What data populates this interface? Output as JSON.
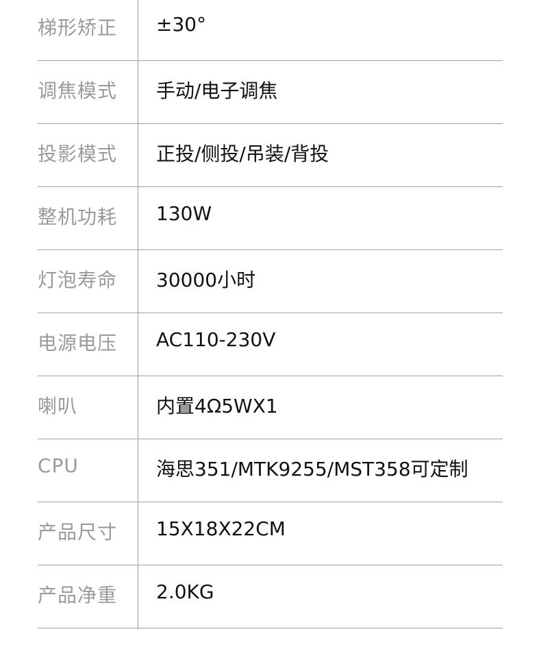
{
  "specs": [
    {
      "label": "梯形矫正",
      "value": "±30°"
    },
    {
      "label": "调焦模式",
      "value": "手动/电子调焦"
    },
    {
      "label": "投影模式",
      "value": "正投/侧投/吊装/背投"
    },
    {
      "label": "整机功耗",
      "value": "130W"
    },
    {
      "label": "灯泡寿命",
      "value": "30000小时"
    },
    {
      "label": "电源电压",
      "value": "AC110-230V"
    },
    {
      "label": "喇叭",
      "value": "内置4Ω5WX1"
    },
    {
      "label": "CPU",
      "value": "海思351/MTK9255/MST358可定制"
    },
    {
      "label": "产品尺寸",
      "value": "15X18X22CM"
    },
    {
      "label": "产品净重",
      "value": "2.0KG"
    }
  ]
}
